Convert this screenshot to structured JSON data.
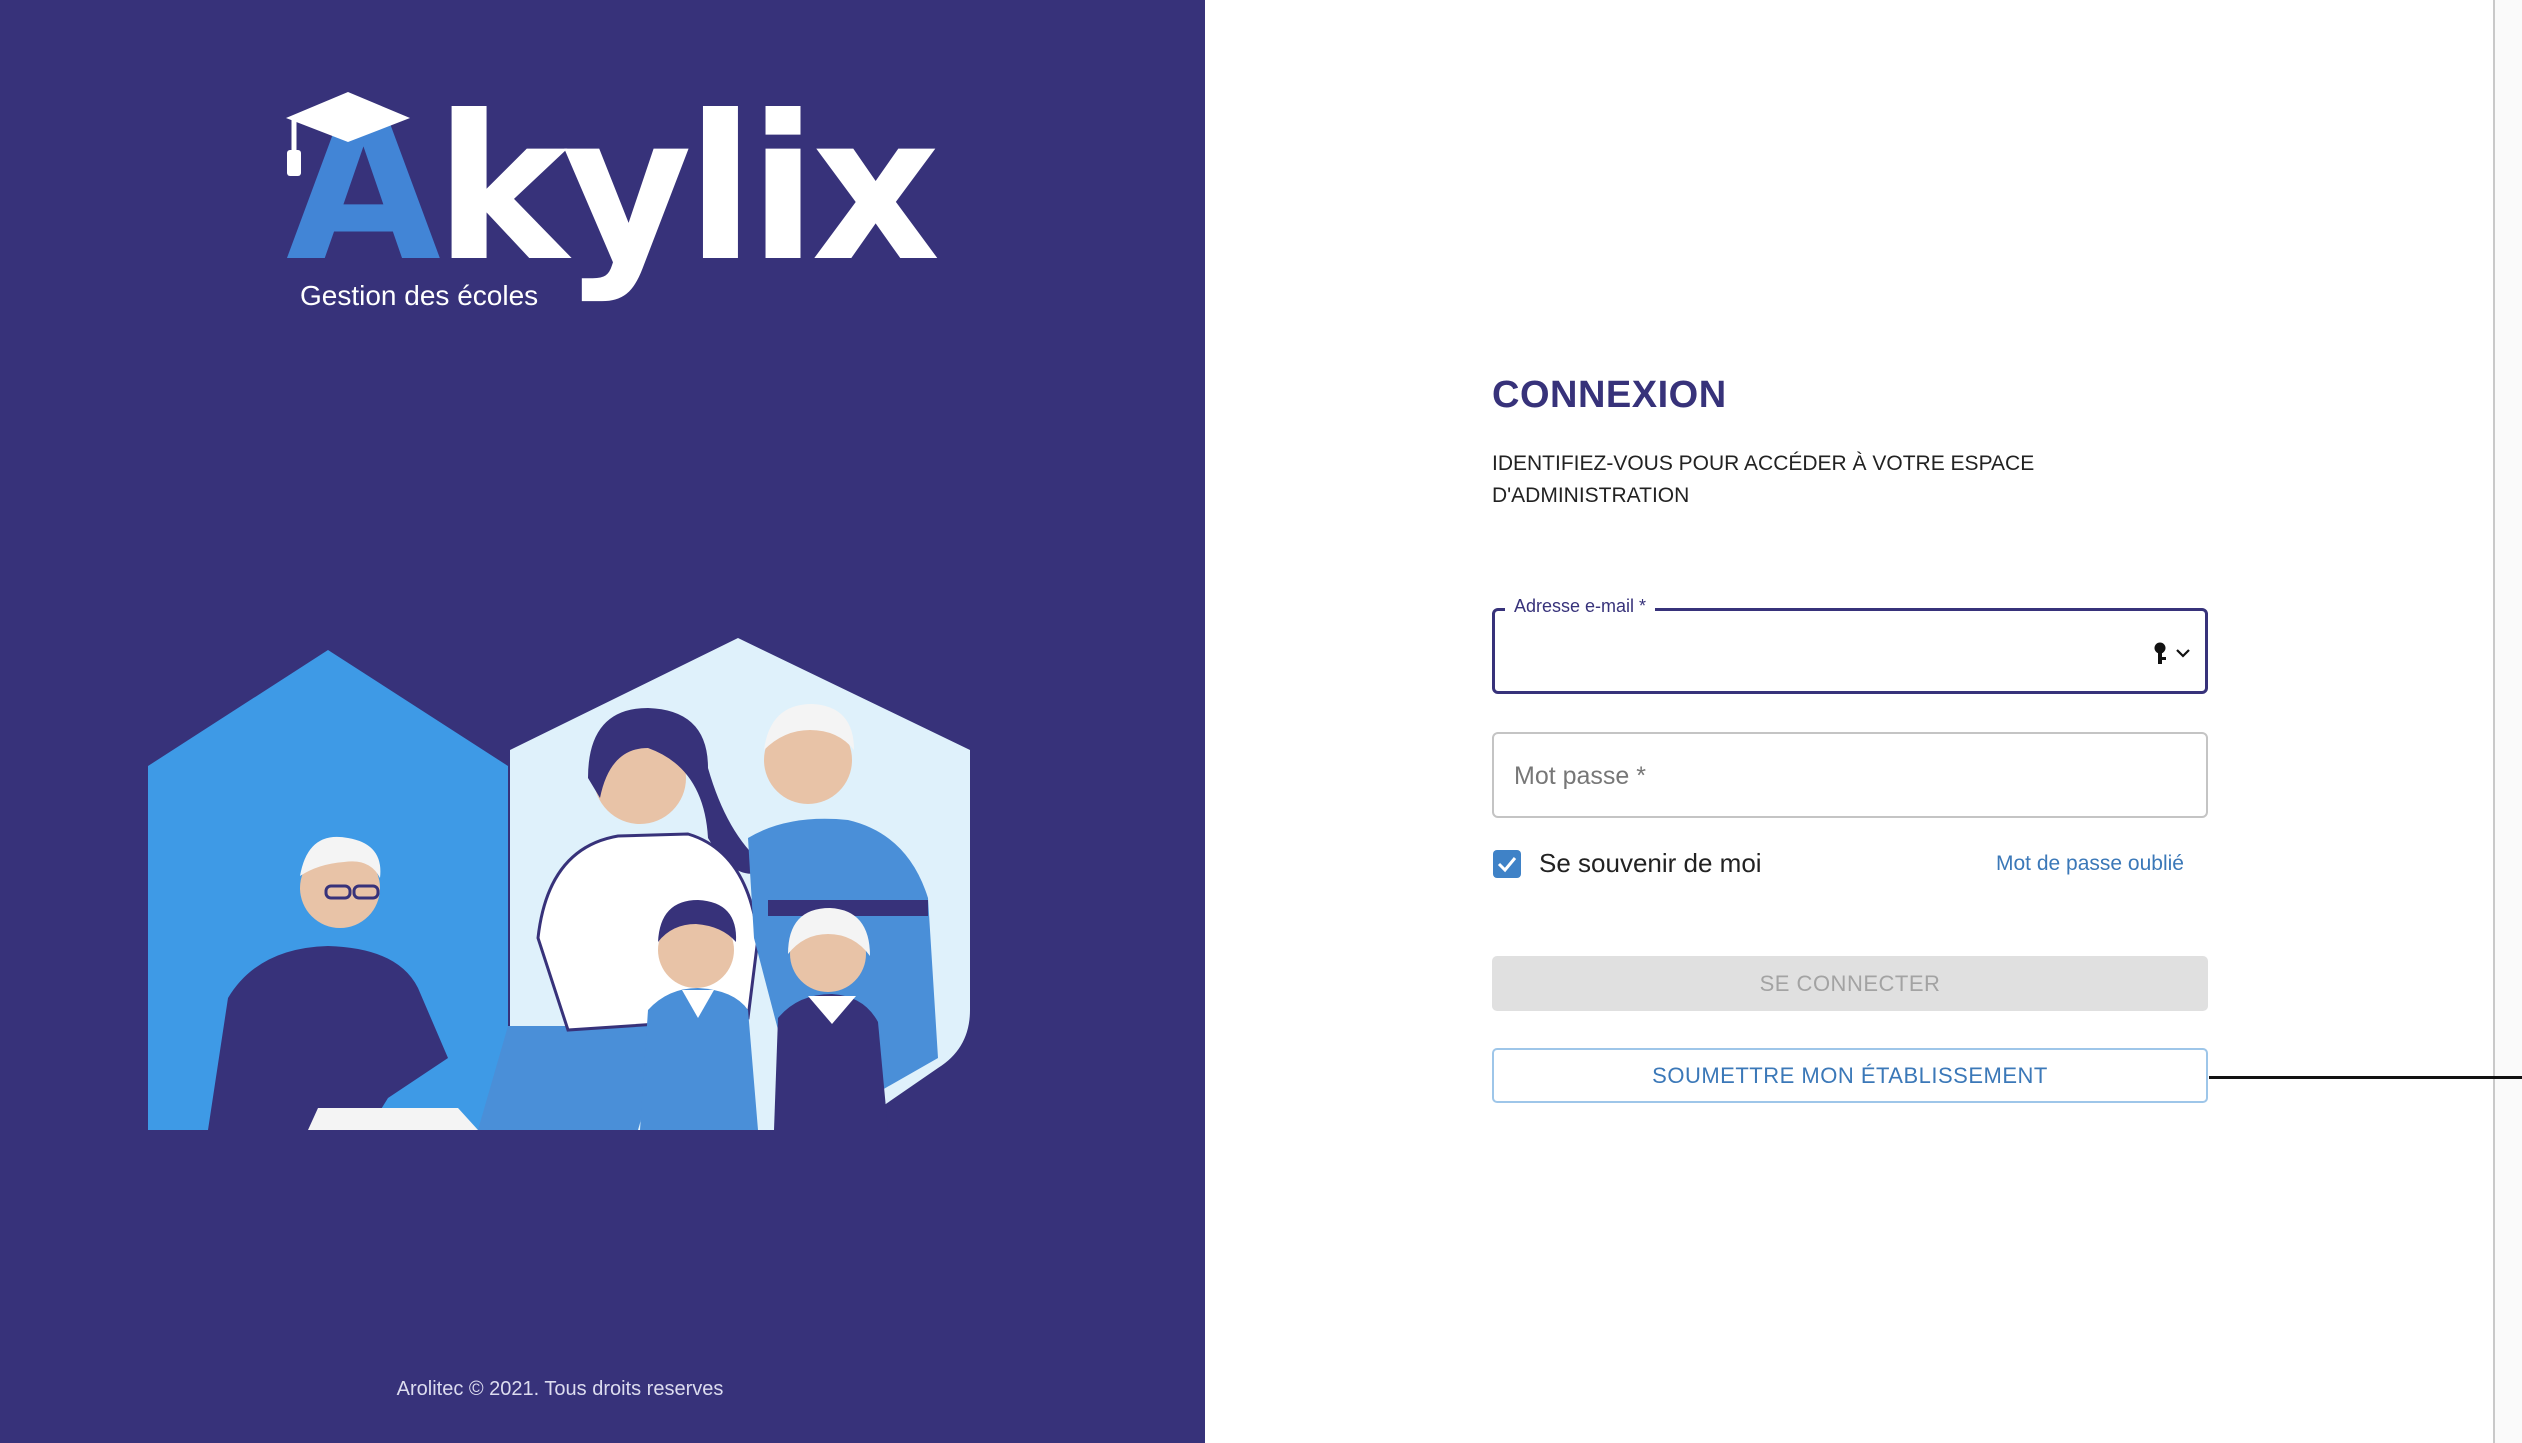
{
  "branding": {
    "logo_initial": "A",
    "logo_rest": "kylix",
    "logo_tagline": "Gestion des écoles",
    "footer": "Arolitec © 2021. Tous droits reserves"
  },
  "login": {
    "title": "CONNEXION",
    "subtitle": "IDENTIFIEZ-VOUS POUR ACCÉDER À VOTRE ESPACE D'ADMINISTRATION",
    "email_label": "Adresse e-mail *",
    "email_value": "",
    "password_label": "Mot passe *",
    "password_value": "",
    "remember_label": "Se souvenir de moi",
    "remember_checked": true,
    "forgot_label": "Mot de passe oublié",
    "login_button": "SE CONNECTER",
    "submit_school_button": "SOUMETTRE MON ÉTABLISSEMENT"
  },
  "icons": {
    "email_field_icon": "key-icon",
    "checkbox_icon": "checkmark-icon"
  },
  "colors": {
    "brand_dark": "#37327a",
    "brand_blue": "#4285d6",
    "link_blue": "#3b78b8",
    "checkbox_blue": "#3f82c7",
    "disabled_button": "#e0e0e0"
  }
}
